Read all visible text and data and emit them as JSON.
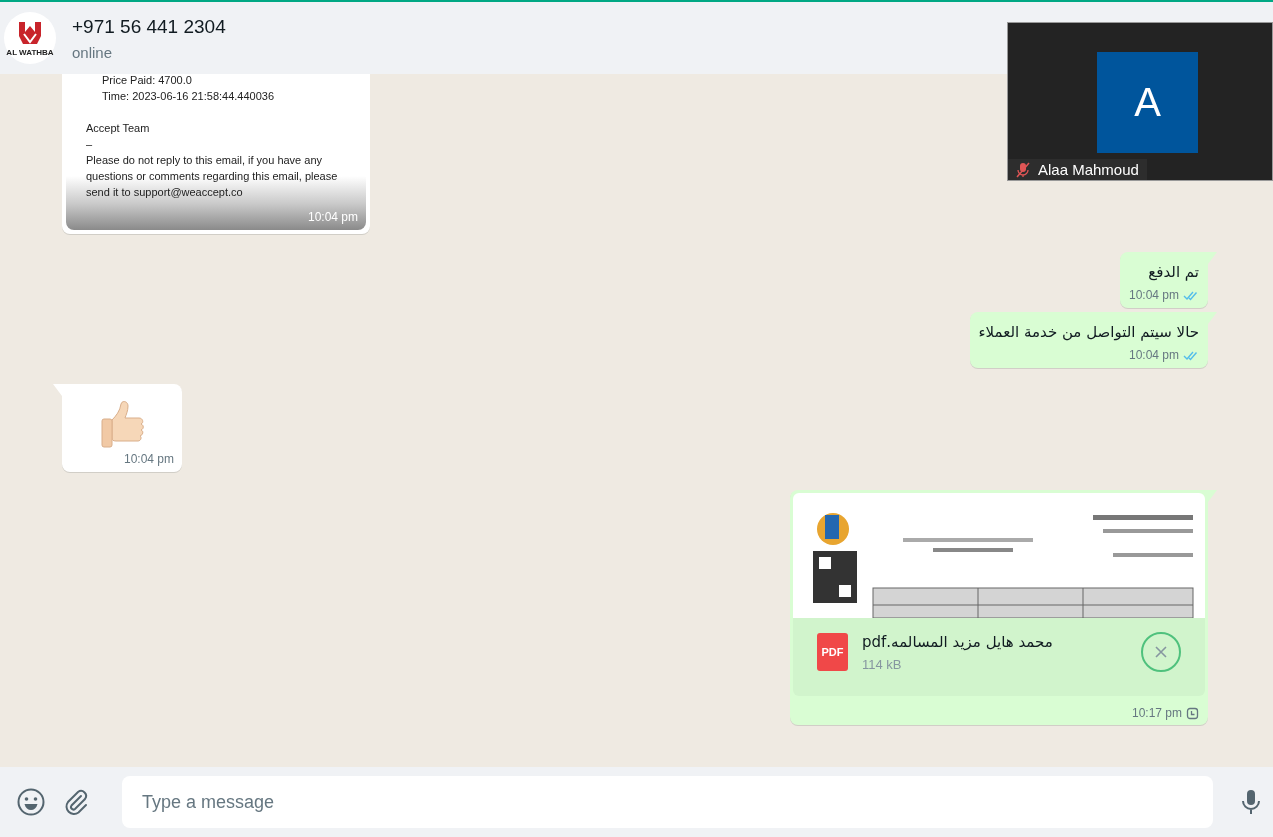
{
  "header": {
    "avatar_caption": "AL WATHBA",
    "contact_name": "+971 56 441 2304",
    "status": "online"
  },
  "call_overlay": {
    "initial": "A",
    "name": "Alaa Mahmoud",
    "muted": true
  },
  "messages": [
    {
      "kind": "email",
      "outgoing": false,
      "time": "10:04 pm",
      "lines": [
        {
          "kind": "detail",
          "text": "Price Paid: 4700.0"
        },
        {
          "kind": "detail",
          "text": "Time: 2023-06-16 21:58:44.440036"
        },
        {
          "kind": "plain",
          "text": "Accept Team"
        },
        {
          "kind": "plain",
          "text": "–"
        },
        {
          "kind": "plain",
          "text": "Please do not reply to this email, if you have any questions or comments regarding this email, please send it to support@weaccept.co"
        }
      ]
    },
    {
      "kind": "text",
      "outgoing": true,
      "text": "تم الدفع",
      "time": "10:04 pm",
      "read": true
    },
    {
      "kind": "text",
      "outgoing": true,
      "text": "حالا سيتم التواصل من خدمة العملاء",
      "time": "10:04 pm",
      "read": true
    },
    {
      "kind": "sticker",
      "outgoing": false,
      "time": "10:04 pm"
    },
    {
      "kind": "document",
      "outgoing": true,
      "file_type": "PDF",
      "file_name": "محمد هايل مزيد المسالمه.pdf",
      "size": "114 kB",
      "time": "10:17 pm",
      "pending": true
    }
  ],
  "composer": {
    "placeholder": "Type a message"
  }
}
